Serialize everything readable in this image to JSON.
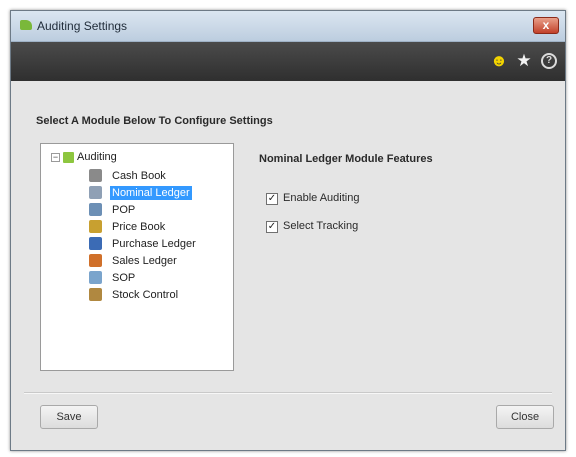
{
  "window": {
    "title": "Auditing Settings",
    "close_glyph": "x"
  },
  "toolbar": {
    "icons": [
      "smiley-icon",
      "star-icon",
      "help-icon"
    ],
    "smiley_glyph": "☻",
    "star_glyph": "★",
    "help_glyph": "?"
  },
  "instruction": "Select A Module Below To Configure Settings",
  "tree": {
    "expander": "−",
    "root_label": "Auditing",
    "items": [
      {
        "label": "Cash Book",
        "color": "#8a8a8a",
        "selected": false
      },
      {
        "label": "Nominal Ledger",
        "color": "#8fa0b5",
        "selected": true
      },
      {
        "label": "POP",
        "color": "#6c8fb5",
        "selected": false
      },
      {
        "label": "Price Book",
        "color": "#c8a030",
        "selected": false
      },
      {
        "label": "Purchase Ledger",
        "color": "#3b6bb5",
        "selected": false
      },
      {
        "label": "Sales Ledger",
        "color": "#d0702a",
        "selected": false
      },
      {
        "label": "SOP",
        "color": "#7aa4cc",
        "selected": false
      },
      {
        "label": "Stock Control",
        "color": "#b08840",
        "selected": false
      }
    ]
  },
  "features": {
    "title": "Nominal Ledger Module Features",
    "options": [
      {
        "label": "Enable Auditing",
        "checked": true
      },
      {
        "label": "Select Tracking",
        "checked": true
      }
    ],
    "check_glyph": "✓"
  },
  "buttons": {
    "save_label": "Save",
    "close_label": "Close"
  },
  "colors": {
    "toolbar": "#3a3a3a",
    "selection": "#3399ff",
    "dialog_bg": "#e5e5e5"
  }
}
